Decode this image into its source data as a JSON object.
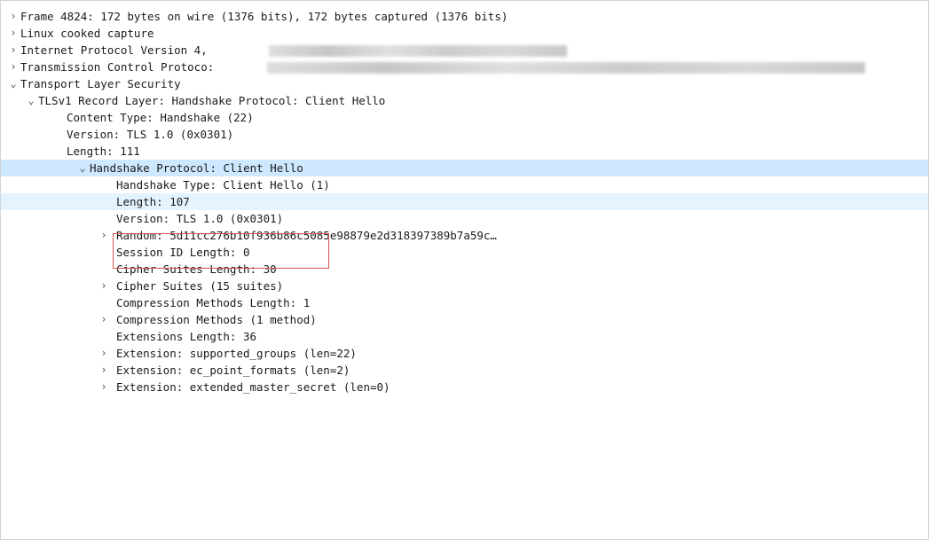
{
  "tree": [
    {
      "id": "frame",
      "label": "Frame 4824: 172 bytes on wire (1376 bits), 172 bytes captured (1376 bits)",
      "toggle": "›",
      "indent": 0
    },
    {
      "id": "linux",
      "label": "Linux cooked capture",
      "toggle": "›",
      "indent": 0
    },
    {
      "id": "ipv4",
      "label": "Internet Protocol Version 4,",
      "toggle": "›",
      "indent": 0
    },
    {
      "id": "tcp",
      "label": "Transmission Control Protoco:",
      "toggle": "›",
      "indent": 0
    },
    {
      "id": "tls",
      "label": "Transport Layer Security",
      "toggle": "⌄",
      "indent": 0
    },
    {
      "id": "record",
      "label": "TLSv1 Record Layer: Handshake Protocol: Client Hello",
      "toggle": "⌄",
      "indent": 1
    },
    {
      "id": "ctype",
      "label": "Content Type: Handshake (22)",
      "toggle": "",
      "indent": 2
    },
    {
      "id": "rversion",
      "label": "Version: TLS 1.0 (0x0301)",
      "toggle": "",
      "indent": 2
    },
    {
      "id": "rlength",
      "label": "Length: 111",
      "toggle": "",
      "indent": 2
    },
    {
      "id": "hs",
      "label": "Handshake Protocol: Client Hello",
      "toggle": "⌄",
      "indent": 2
    },
    {
      "id": "hstype",
      "label": "Handshake Type: Client Hello (1)",
      "toggle": "",
      "indent": 3
    },
    {
      "id": "hslength",
      "label": "Length: 107",
      "toggle": "",
      "indent": 3
    },
    {
      "id": "hsversion",
      "label": "Version: TLS 1.0 (0x0301)",
      "toggle": "",
      "indent": 3
    },
    {
      "id": "random",
      "label": "Random: 5d11cc276b10f936b86c5085e98879e2d318397389b7a59c…",
      "toggle": "›",
      "indent": 3
    },
    {
      "id": "sidlen",
      "label": "Session ID Length: 0",
      "toggle": "",
      "indent": 3
    },
    {
      "id": "cslen",
      "label": "Cipher Suites Length: 30",
      "toggle": "",
      "indent": 3
    },
    {
      "id": "cs",
      "label": "Cipher Suites (15 suites)",
      "toggle": "›",
      "indent": 3
    },
    {
      "id": "cmlen",
      "label": "Compression Methods Length: 1",
      "toggle": "",
      "indent": 3
    },
    {
      "id": "cm",
      "label": "Compression Methods (1 method)",
      "toggle": "›",
      "indent": 3
    },
    {
      "id": "extlen",
      "label": "Extensions Length: 36",
      "toggle": "",
      "indent": 3
    },
    {
      "id": "ext1",
      "label": "Extension: supported_groups (len=22)",
      "toggle": "›",
      "indent": 3
    },
    {
      "id": "ext2",
      "label": "Extension: ec_point_formats (len=2)",
      "toggle": "›",
      "indent": 3
    },
    {
      "id": "ext3",
      "label": "Extension: extended_master_secret (len=0)",
      "toggle": "›",
      "indent": 3
    }
  ]
}
